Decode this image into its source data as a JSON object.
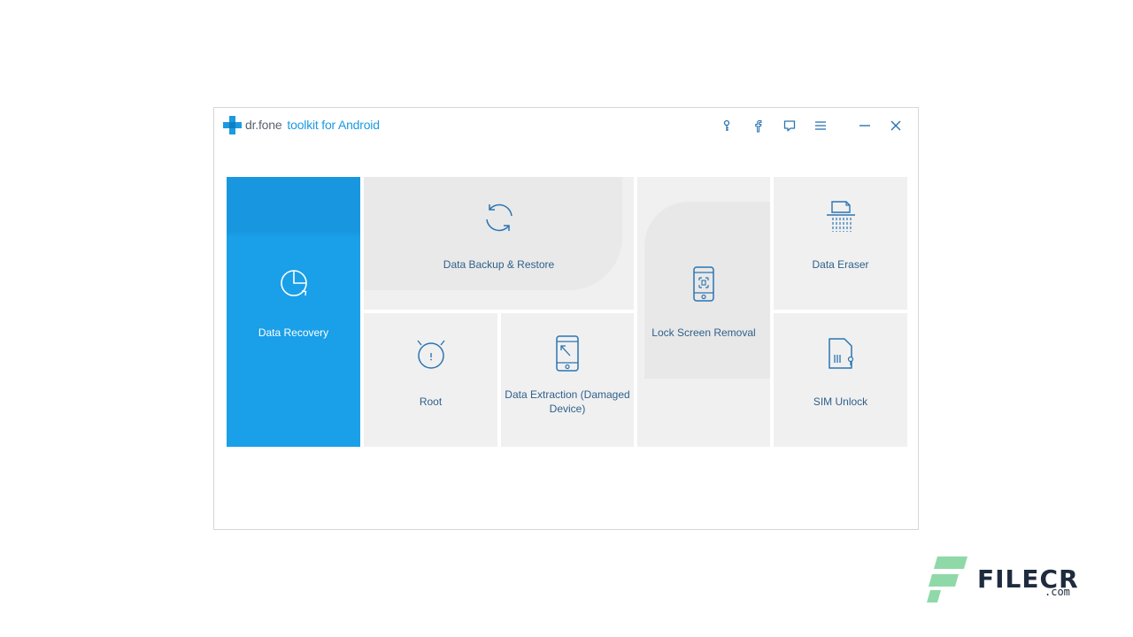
{
  "window": {
    "brand_name": "dr.fone",
    "product_name": "toolkit for Android",
    "accent": "#1b9ae0"
  },
  "titlebar_icons": [
    {
      "name": "key-icon"
    },
    {
      "name": "facebook-icon"
    },
    {
      "name": "feedback-icon"
    },
    {
      "name": "menu-icon"
    },
    {
      "name": "minimize-icon"
    },
    {
      "name": "close-icon"
    }
  ],
  "tiles": {
    "data_recovery": {
      "label": "Data Recovery",
      "icon": "pie-chart-icon",
      "color": "#1a9fe9"
    },
    "backup_restore": {
      "label": "Data Backup & Restore",
      "icon": "sync-icon"
    },
    "lock_screen": {
      "label": "Lock Screen Removal",
      "icon": "phone-lock-icon"
    },
    "data_eraser": {
      "label": "Data Eraser",
      "icon": "shredder-icon"
    },
    "root": {
      "label": "Root",
      "icon": "android-head-icon"
    },
    "data_extraction": {
      "label": "Data Extraction (Damaged Device)",
      "icon": "phone-extract-icon"
    },
    "sim_unlock": {
      "label": "SIM Unlock",
      "icon": "sim-card-icon"
    }
  },
  "watermark": {
    "text": "FILECR",
    "suffix": ".com"
  }
}
